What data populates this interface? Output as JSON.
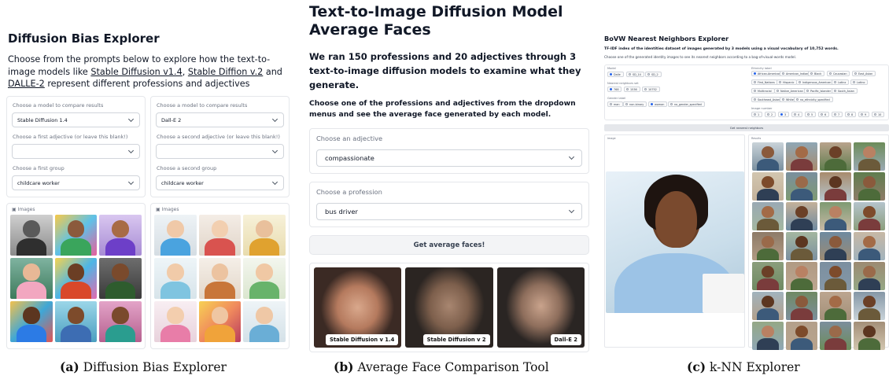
{
  "panel_a": {
    "title": "Diffusion Bias Explorer",
    "desc_pre": "Choose from the prompts below to explore how the text-to-image models like ",
    "link1": "Stable Diffusion v1.4",
    "sep1": ", ",
    "link2": "Stable Diffion v.2",
    "sep2": " and ",
    "link3": "DALLE-2",
    "desc_post": " represent different professions and adjectives",
    "left": {
      "model_label": "Choose a model to compare results",
      "model_value": "Stable Diffusion 1.4",
      "adj_label": "Choose a first adjective (or leave this blank!)",
      "adj_value": "",
      "group_label": "Choose a first group",
      "group_value": "childcare worker",
      "gallery_label": "Images"
    },
    "right": {
      "model_label": "Choose a model to compare results",
      "model_value": "Dall-E 2",
      "adj_label": "Choose a second adjective (or leave this blank!)",
      "adj_value": "",
      "group_label": "Choose a second group",
      "group_value": "childcare worker",
      "gallery_label": "Images"
    },
    "caption_letter": "(a)",
    "caption_text": " Diffusion Bias Explorer"
  },
  "panel_b": {
    "title": "Text-to-Image Diffusion Model Average Faces",
    "desc1": "We ran 150 professions and 20 adjectives through 3 text-to-image diffusion models to examine what they generate.",
    "desc2": "Choose one of the professions and adjectives from the dropdown menus and see the average face generated by each model.",
    "adj_label": "Choose an adjective",
    "adj_value": "compassionate",
    "prof_label": "Choose a profession",
    "prof_value": "bus driver",
    "button": "Get average faces!",
    "faces": [
      "Stable Diffusion v 1.4",
      "Stable Diffusion v 2",
      "Dall-E 2"
    ],
    "caption_letter": "(b)",
    "caption_text": " Average Face Comparison Tool"
  },
  "panel_c": {
    "title": "BoVW Nearest Neighbors Explorer",
    "sub1": "TF-IDF index of the identities dataset of images generated by 3 models using a visual vocabulary of 10,752 words.",
    "sub2": "Choose one of the generated identity images to see its nearest neighbors according to a bag-of-visual-words model.",
    "model_label": "Model",
    "models": [
      "Dalle",
      "SD_14",
      "SD_2"
    ],
    "nn_label": "Nearest neighbors set",
    "nn_sets": [
      "768",
      "1536",
      "10752"
    ],
    "gender_label": "Gender label",
    "genders": [
      "man",
      "non-binary",
      "woman",
      "no_gender_specified"
    ],
    "eth_label": "Ethnicity label",
    "ethnicities": [
      "African-American",
      "American_Indian",
      "Black",
      "Caucasian",
      "East_Asian",
      "First_Nations",
      "Hispanic",
      "Indigenous_American",
      "Latinx",
      "Latino",
      "Multiracial",
      "Native_American",
      "Pacific_Islander",
      "South_Asian",
      "Southeast_Asian",
      "White",
      "no_ethnicity_specified"
    ],
    "num_label": "Image number",
    "numbers": [
      "1",
      "2",
      "3",
      "4",
      "5",
      "6",
      "7",
      "8",
      "9",
      "10"
    ],
    "get_button": "Get nearest neighbors",
    "image_tag": "Image",
    "nn_tag": "Results",
    "caption_letter": "(c)",
    "caption_text": " k-NN Explorer"
  }
}
